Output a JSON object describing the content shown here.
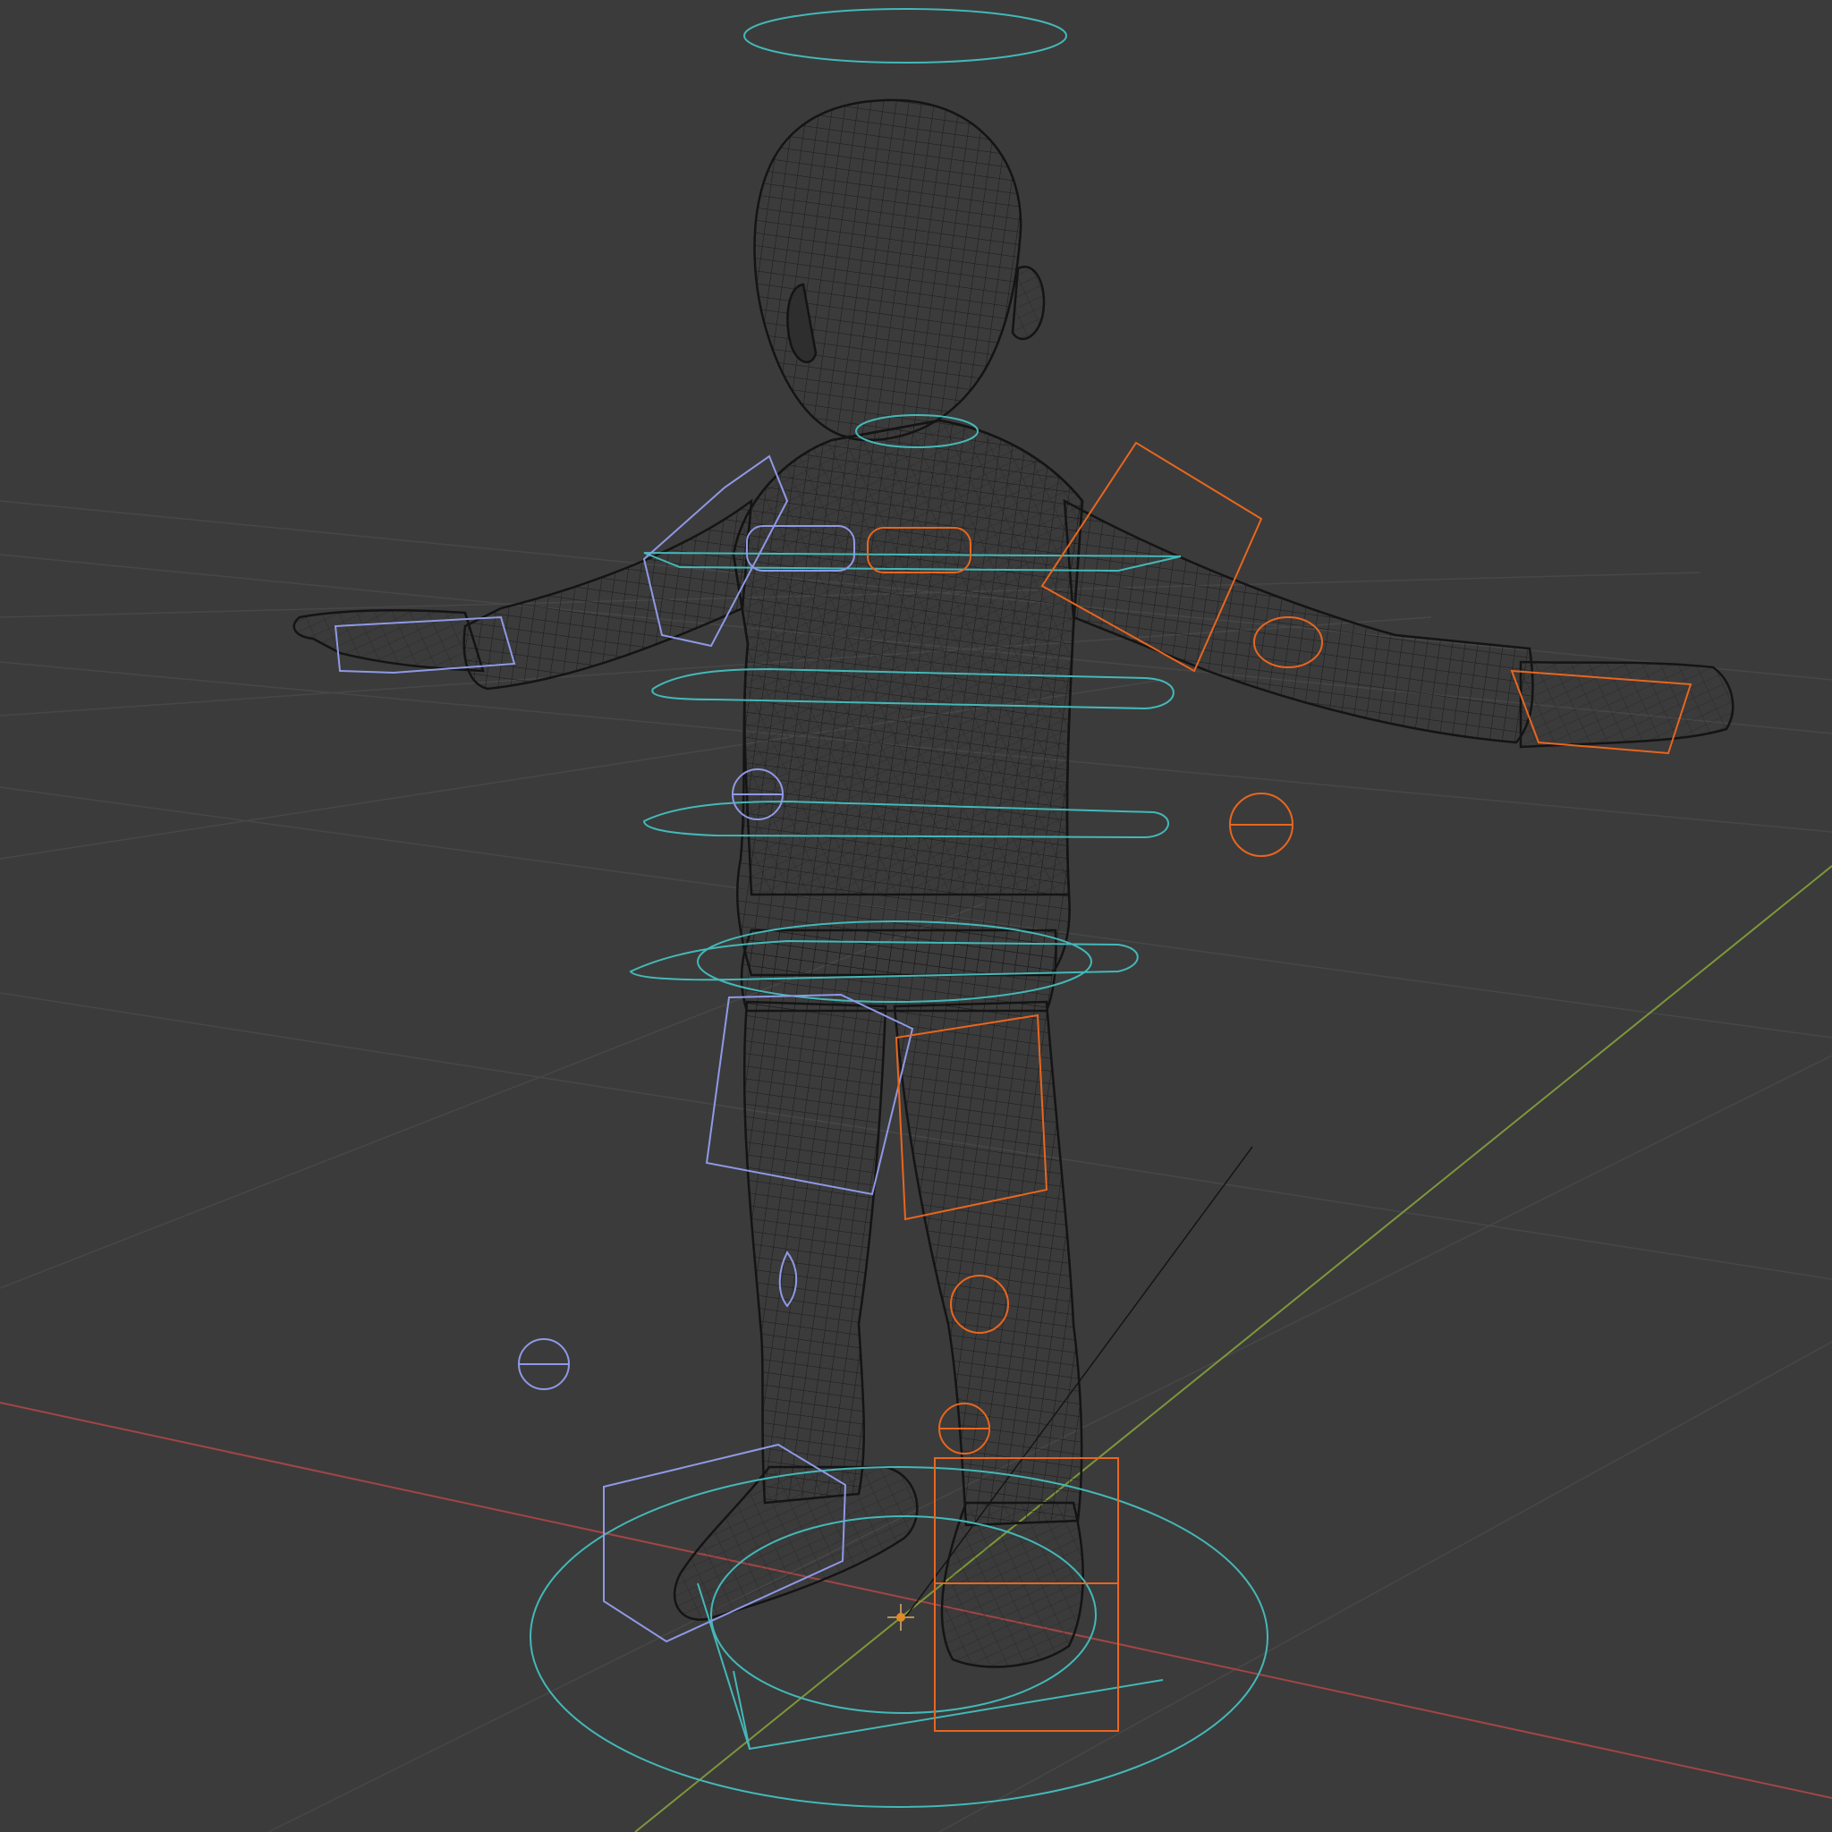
{
  "viewport": {
    "shading": "wireframe",
    "background_color": "#3b3b3b",
    "grid_color": "#4a4a4a",
    "x_axis_color": "#b24a4a",
    "y_axis_color": "#7f9a3a",
    "mesh_color": "#141414"
  },
  "rig": {
    "widget_colors": {
      "center": "#44b8b8",
      "left": "#e8661f",
      "right": "#8f99e6"
    }
  }
}
